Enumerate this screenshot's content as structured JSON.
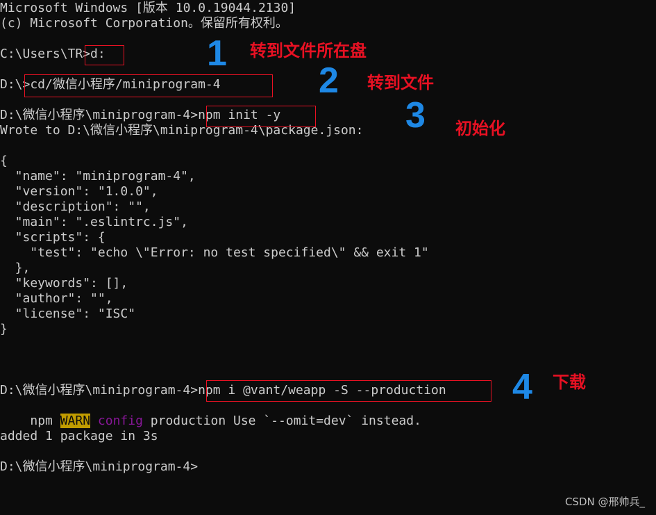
{
  "terminal": {
    "lines": [
      "Microsoft Windows [版本 10.0.19044.2130]",
      "(c) Microsoft Corporation。保留所有权利。",
      "",
      "C:\\Users\\TR>d:",
      "",
      "D:\\>cd/微信小程序/miniprogram-4",
      "",
      "D:\\微信小程序\\miniprogram-4>npm init -y",
      "Wrote to D:\\微信小程序\\miniprogram-4\\package.json:",
      "",
      "{",
      "  \"name\": \"miniprogram-4\",",
      "  \"version\": \"1.0.0\",",
      "  \"description\": \"\",",
      "  \"main\": \".eslintrc.js\",",
      "  \"scripts\": {",
      "    \"test\": \"echo \\\"Error: no test specified\\\" && exit 1\"",
      "  },",
      "  \"keywords\": [],",
      "  \"author\": \"\",",
      "  \"license\": \"ISC\"",
      "}",
      "",
      "",
      "",
      "D:\\微信小程序\\miniprogram-4>npm i @vant/weapp -S --production",
      "",
      "",
      "added 1 package in 3s",
      "",
      "D:\\微信小程序\\miniprogram-4>"
    ],
    "warn_line": {
      "prefix": "npm ",
      "warn": "WARN",
      "config": "config",
      "rest": " production Use `--omit=dev` instead."
    }
  },
  "annotations": [
    {
      "number": "1",
      "text": "转到文件所在盘"
    },
    {
      "number": "2",
      "text": "转到文件"
    },
    {
      "number": "3",
      "text": "初始化"
    },
    {
      "number": "4",
      "text": "下载"
    }
  ],
  "colors": {
    "background": "#0c0c0c",
    "text": "#cccccc",
    "warn_bg": "#c19c00",
    "config": "#881798",
    "annotation_red": "#e81123",
    "annotation_blue": "#1e88e5"
  },
  "watermark": "CSDN @邢帅兵_"
}
